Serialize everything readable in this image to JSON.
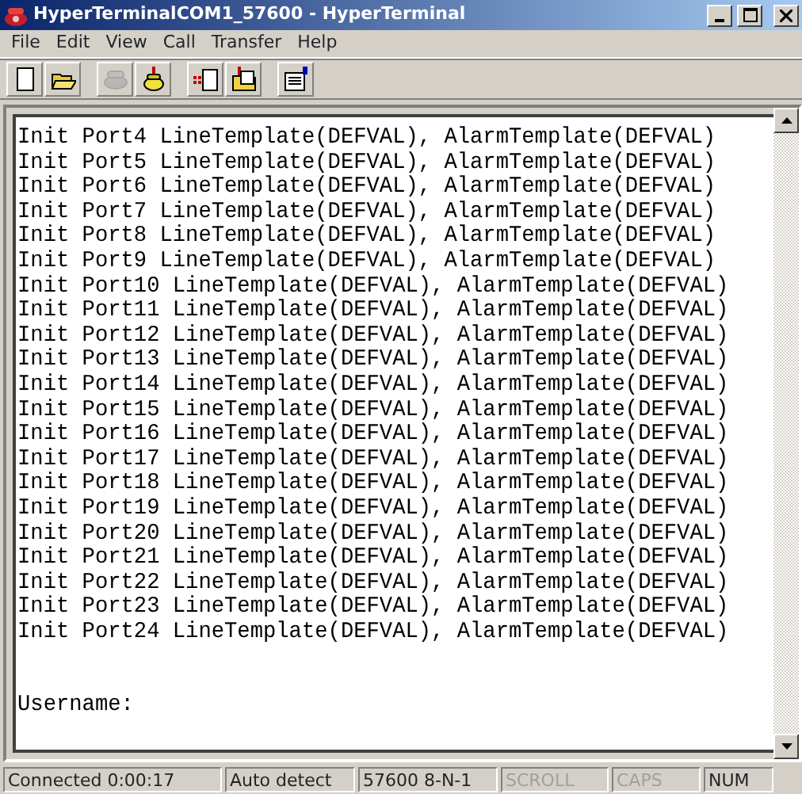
{
  "window": {
    "title": "HyperTerminalCOM1_57600 - HyperTerminal"
  },
  "menu": [
    "File",
    "Edit",
    "View",
    "Call",
    "Transfer",
    "Help"
  ],
  "toolbar": [
    {
      "kind": "new",
      "disabled": false
    },
    {
      "kind": "open",
      "disabled": false
    },
    {
      "kind": "sep"
    },
    {
      "kind": "call",
      "disabled": true
    },
    {
      "kind": "hangup",
      "disabled": false
    },
    {
      "kind": "sep"
    },
    {
      "kind": "send",
      "disabled": false
    },
    {
      "kind": "receive",
      "disabled": false
    },
    {
      "kind": "sep"
    },
    {
      "kind": "properties",
      "disabled": false
    }
  ],
  "terminal": {
    "lines": [
      "Init Port4 LineTemplate(DEFVAL), AlarmTemplate(DEFVAL)",
      "Init Port5 LineTemplate(DEFVAL), AlarmTemplate(DEFVAL)",
      "Init Port6 LineTemplate(DEFVAL), AlarmTemplate(DEFVAL)",
      "Init Port7 LineTemplate(DEFVAL), AlarmTemplate(DEFVAL)",
      "Init Port8 LineTemplate(DEFVAL), AlarmTemplate(DEFVAL)",
      "Init Port9 LineTemplate(DEFVAL), AlarmTemplate(DEFVAL)",
      "Init Port10 LineTemplate(DEFVAL), AlarmTemplate(DEFVAL)",
      "Init Port11 LineTemplate(DEFVAL), AlarmTemplate(DEFVAL)",
      "Init Port12 LineTemplate(DEFVAL), AlarmTemplate(DEFVAL)",
      "Init Port13 LineTemplate(DEFVAL), AlarmTemplate(DEFVAL)",
      "Init Port14 LineTemplate(DEFVAL), AlarmTemplate(DEFVAL)",
      "Init Port15 LineTemplate(DEFVAL), AlarmTemplate(DEFVAL)",
      "Init Port16 LineTemplate(DEFVAL), AlarmTemplate(DEFVAL)",
      "Init Port17 LineTemplate(DEFVAL), AlarmTemplate(DEFVAL)",
      "Init Port18 LineTemplate(DEFVAL), AlarmTemplate(DEFVAL)",
      "Init Port19 LineTemplate(DEFVAL), AlarmTemplate(DEFVAL)",
      "Init Port20 LineTemplate(DEFVAL), AlarmTemplate(DEFVAL)",
      "Init Port21 LineTemplate(DEFVAL), AlarmTemplate(DEFVAL)",
      "Init Port22 LineTemplate(DEFVAL), AlarmTemplate(DEFVAL)",
      "Init Port23 LineTemplate(DEFVAL), AlarmTemplate(DEFVAL)",
      "Init Port24 LineTemplate(DEFVAL), AlarmTemplate(DEFVAL)"
    ],
    "prompt": "Username:"
  },
  "status_bar": [
    {
      "text": "Connected 0:00:17",
      "disabled": false
    },
    {
      "text": "Auto detect",
      "disabled": false
    },
    {
      "text": "57600 8-N-1",
      "disabled": false
    },
    {
      "text": "SCROLL",
      "disabled": true
    },
    {
      "text": "CAPS",
      "disabled": true
    },
    {
      "text": "NUM",
      "disabled": false
    }
  ]
}
